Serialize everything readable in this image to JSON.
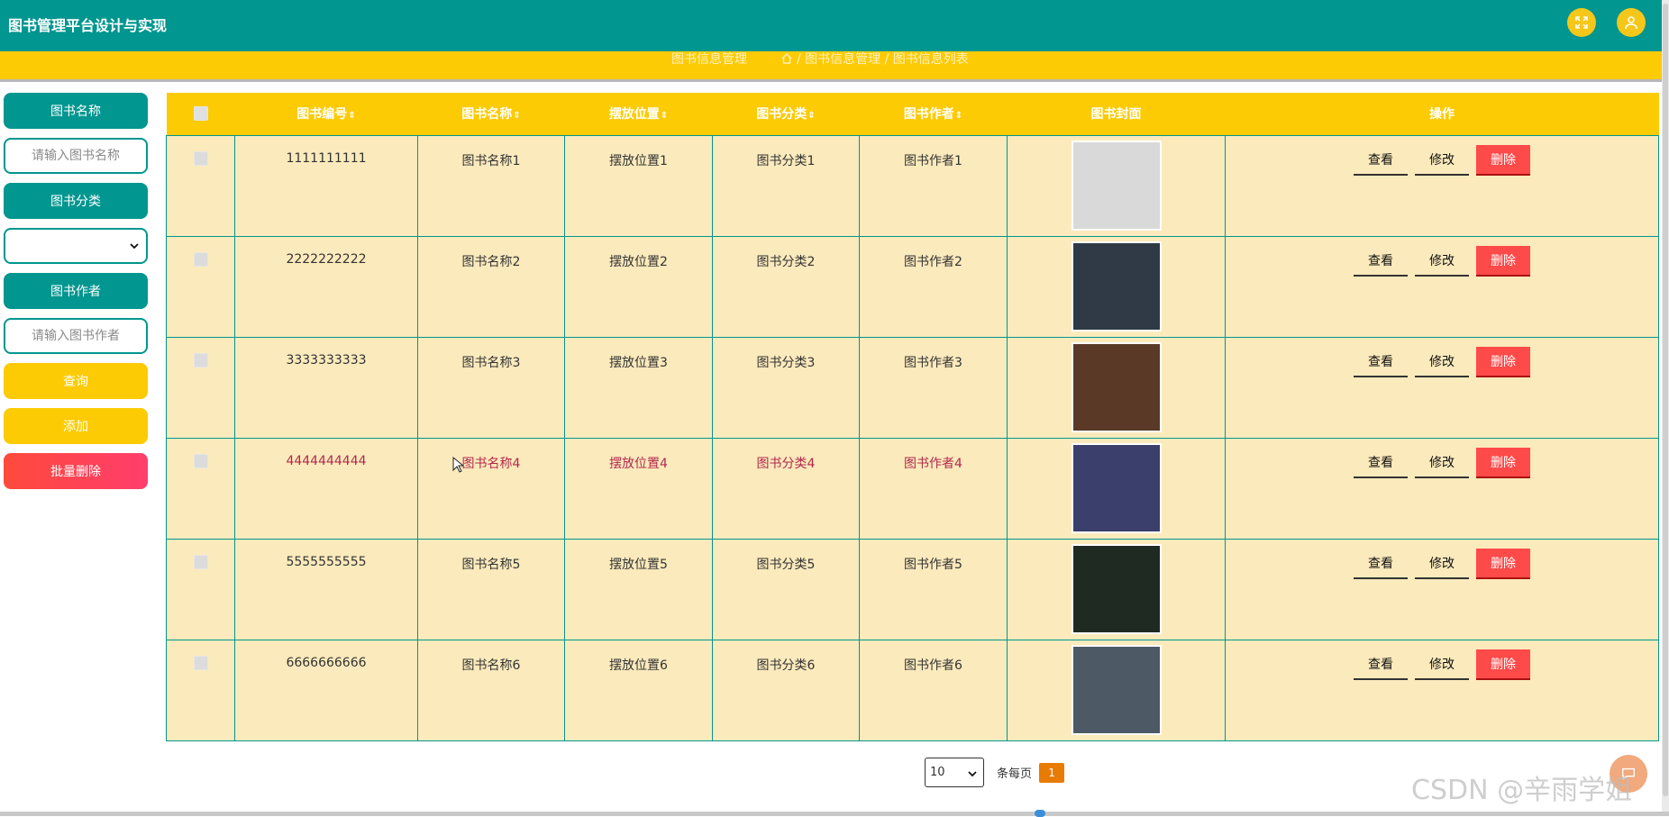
{
  "app": {
    "title": "图书管理平台设计与实现"
  },
  "topbar": {
    "fullscreen_icon": "fullscreen-icon",
    "user_icon": "user-icon",
    "icon_color": "#f5c71a",
    "bg_color": "#01968f"
  },
  "breadcrumb": {
    "section": "图书信息管理",
    "path": "/ 图书信息管理 / 图书信息列表",
    "home_icon": "home-icon"
  },
  "sidebar": {
    "name_label": "图书名称",
    "name_placeholder": "请输入图书名称",
    "category_label": "图书分类",
    "category_value": "",
    "author_label": "图书作者",
    "author_placeholder": "请输入图书作者",
    "query_button": "查询",
    "add_button": "添加",
    "batch_delete_button": "批量删除"
  },
  "table": {
    "headers": {
      "id": "图书编号",
      "name": "图书名称",
      "location": "摆放位置",
      "category": "图书分类",
      "author": "图书作者",
      "cover": "图书封面",
      "actions": "操作"
    },
    "sort_icon": "⇕",
    "rows": [
      {
        "id": "1111111111",
        "name": "图书名称1",
        "location": "摆放位置1",
        "category": "图书分类1",
        "author": "图书作者1",
        "cover_color": "#d9d9d9"
      },
      {
        "id": "2222222222",
        "name": "图书名称2",
        "location": "摆放位置2",
        "category": "图书分类2",
        "author": "图书作者2",
        "cover_color": "#2f3a46"
      },
      {
        "id": "3333333333",
        "name": "图书名称3",
        "location": "摆放位置3",
        "category": "图书分类3",
        "author": "图书作者3",
        "cover_color": "#5a3a26"
      },
      {
        "id": "4444444444",
        "name": "图书名称4",
        "location": "摆放位置4",
        "category": "图书分类4",
        "author": "图书作者4",
        "cover_color": "#3b3f6b"
      },
      {
        "id": "5555555555",
        "name": "图书名称5",
        "location": "摆放位置5",
        "category": "图书分类5",
        "author": "图书作者5",
        "cover_color": "#1f2a22"
      },
      {
        "id": "6666666666",
        "name": "图书名称6",
        "location": "摆放位置6",
        "category": "图书分类6",
        "author": "图书作者6",
        "cover_color": "#4d5a66"
      }
    ],
    "view_label": "查看",
    "edit_label": "修改",
    "delete_label": "删除"
  },
  "pagination": {
    "page_size": "10",
    "per_page_label": "条每页",
    "current_page": "1"
  },
  "watermark": "CSDN @辛雨学姐"
}
